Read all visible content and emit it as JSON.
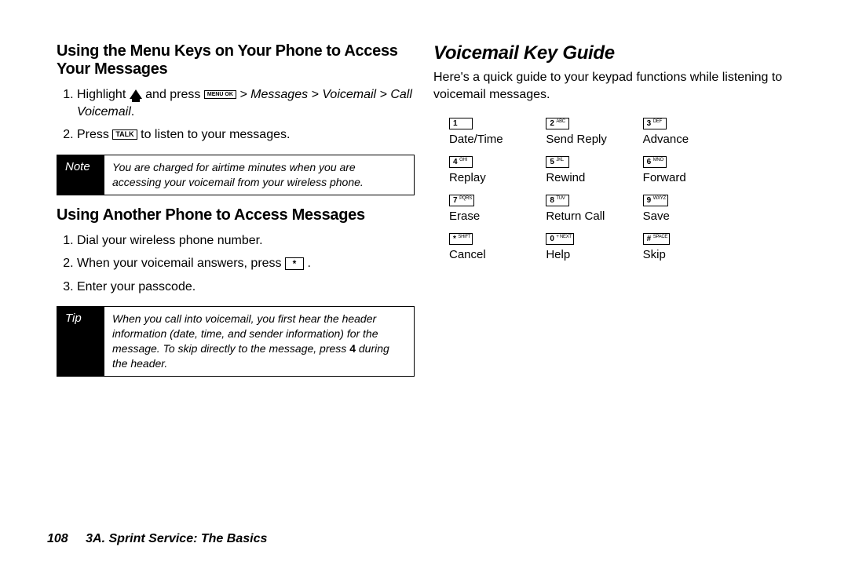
{
  "left": {
    "heading1": "Using the Menu Keys on Your Phone to Access Your Messages",
    "steps1": {
      "s1_a": "Highlight ",
      "s1_b": " and press ",
      "s1_path": " > Messages > Voicemail > Call Voicemail",
      "s1_end": ".",
      "s2_a": "Press ",
      "s2_b": " to listen to your messages."
    },
    "note_label": "Note",
    "note_body": "You are charged for airtime minutes when you are accessing your voicemail from your wireless phone.",
    "heading2": "Using Another Phone to Access Messages",
    "steps2": {
      "s1": "Dial your wireless phone number.",
      "s2_a": "When your voicemail answers, press ",
      "s2_b": " .",
      "s3": "Enter your passcode."
    },
    "tip_label": "Tip",
    "tip_body_a": "When you call into voicemail, you first hear the header information (date, time, and sender information) for the message. To skip directly to the message, press ",
    "tip_body_key": "4",
    "tip_body_b": " during the header."
  },
  "right": {
    "heading": "Voicemail Key Guide",
    "intro": "Here's a quick guide to your keypad functions while listening to voicemail messages.",
    "keys": [
      {
        "num": "1",
        "sub": "",
        "label": "Date/Time"
      },
      {
        "num": "2",
        "sub": "ABC",
        "label": "Send Reply"
      },
      {
        "num": "3",
        "sub": "DEF",
        "label": "Advance"
      },
      {
        "num": "4",
        "sub": "GHI",
        "label": "Replay"
      },
      {
        "num": "5",
        "sub": "JKL",
        "label": "Rewind"
      },
      {
        "num": "6",
        "sub": "MNO",
        "label": "Forward"
      },
      {
        "num": "7",
        "sub": "PQRS",
        "label": "Erase"
      },
      {
        "num": "8",
        "sub": "TUV",
        "label": "Return Call"
      },
      {
        "num": "9",
        "sub": "WXYZ",
        "label": "Save"
      },
      {
        "num": "*",
        "sub": "SHIFT",
        "label": "Cancel"
      },
      {
        "num": "0",
        "sub": "+ NEXT",
        "label": "Help"
      },
      {
        "num": "#",
        "sub": "SPACE",
        "label": "Skip"
      }
    ]
  },
  "icons": {
    "menu_ok": "MENU OK",
    "talk": "TALK",
    "star": "*"
  },
  "footer": {
    "page": "108",
    "section": "3A. Sprint Service: The Basics"
  }
}
